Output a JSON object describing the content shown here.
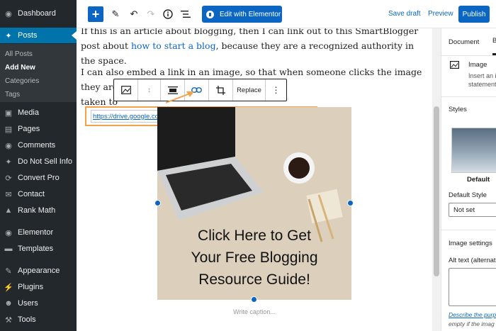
{
  "sidebar": {
    "items": [
      {
        "label": "Dashboard",
        "icon": "dashboard-icon"
      },
      {
        "label": "Posts",
        "icon": "pin-icon"
      },
      {
        "label": "Media",
        "icon": "media-icon"
      },
      {
        "label": "Pages",
        "icon": "pages-icon"
      },
      {
        "label": "Comments",
        "icon": "comments-icon"
      },
      {
        "label": "Do Not Sell Info",
        "icon": "pin-icon"
      },
      {
        "label": "Convert Pro",
        "icon": "convert-pro-icon"
      },
      {
        "label": "Contact",
        "icon": "mail-icon"
      },
      {
        "label": "Rank Math",
        "icon": "chart-icon"
      },
      {
        "label": "Elementor",
        "icon": "elementor-icon"
      },
      {
        "label": "Templates",
        "icon": "folder-icon"
      },
      {
        "label": "Appearance",
        "icon": "brush-icon"
      },
      {
        "label": "Plugins",
        "icon": "plugin-icon"
      },
      {
        "label": "Users",
        "icon": "users-icon"
      },
      {
        "label": "Tools",
        "icon": "wrench-icon"
      }
    ],
    "submenu": [
      "All Posts",
      "Add New",
      "Categories",
      "Tags"
    ]
  },
  "toolbar": {
    "elementor_label": "Edit with Elementor",
    "save_draft": "Save draft",
    "preview": "Preview",
    "publish": "Publish"
  },
  "content": {
    "para1_text": "If this is an article about blogging, then I can link out to this SmartBlogger post about",
    "para1_link": "how to start a blog",
    "para1_rest": ", because they are a recognized authority in the space.",
    "para2_line1": "I can also embed a link in an image, so that when someone clicks the image they are",
    "para2_line2": "taken to",
    "block_toolbar": {
      "replace_label": "Replace"
    },
    "link_url": "https://drive.google.com/file/blogging-resources/view",
    "image_text_lines": [
      "Click Here to Get",
      "Your Free Blogging",
      "Resource Guide!"
    ],
    "caption_placeholder": "Write caption..."
  },
  "settings": {
    "tabs": [
      "Document",
      "Bl"
    ],
    "block_name": "Image",
    "block_desc_lines": [
      "Insert an i",
      "statement."
    ],
    "styles_heading": "Styles",
    "style_default": "Default",
    "default_style_label": "Default Style",
    "default_style_value": "Not set",
    "image_settings_heading": "Image settings",
    "alt_text_label": "Alt text (alternati",
    "describe_link": "Describe the purp",
    "describe_rest": "empty if the imag"
  },
  "colors": {
    "admin_bg": "#23282d",
    "accent": "#0a66c2",
    "highlight": "#f0a34a"
  }
}
